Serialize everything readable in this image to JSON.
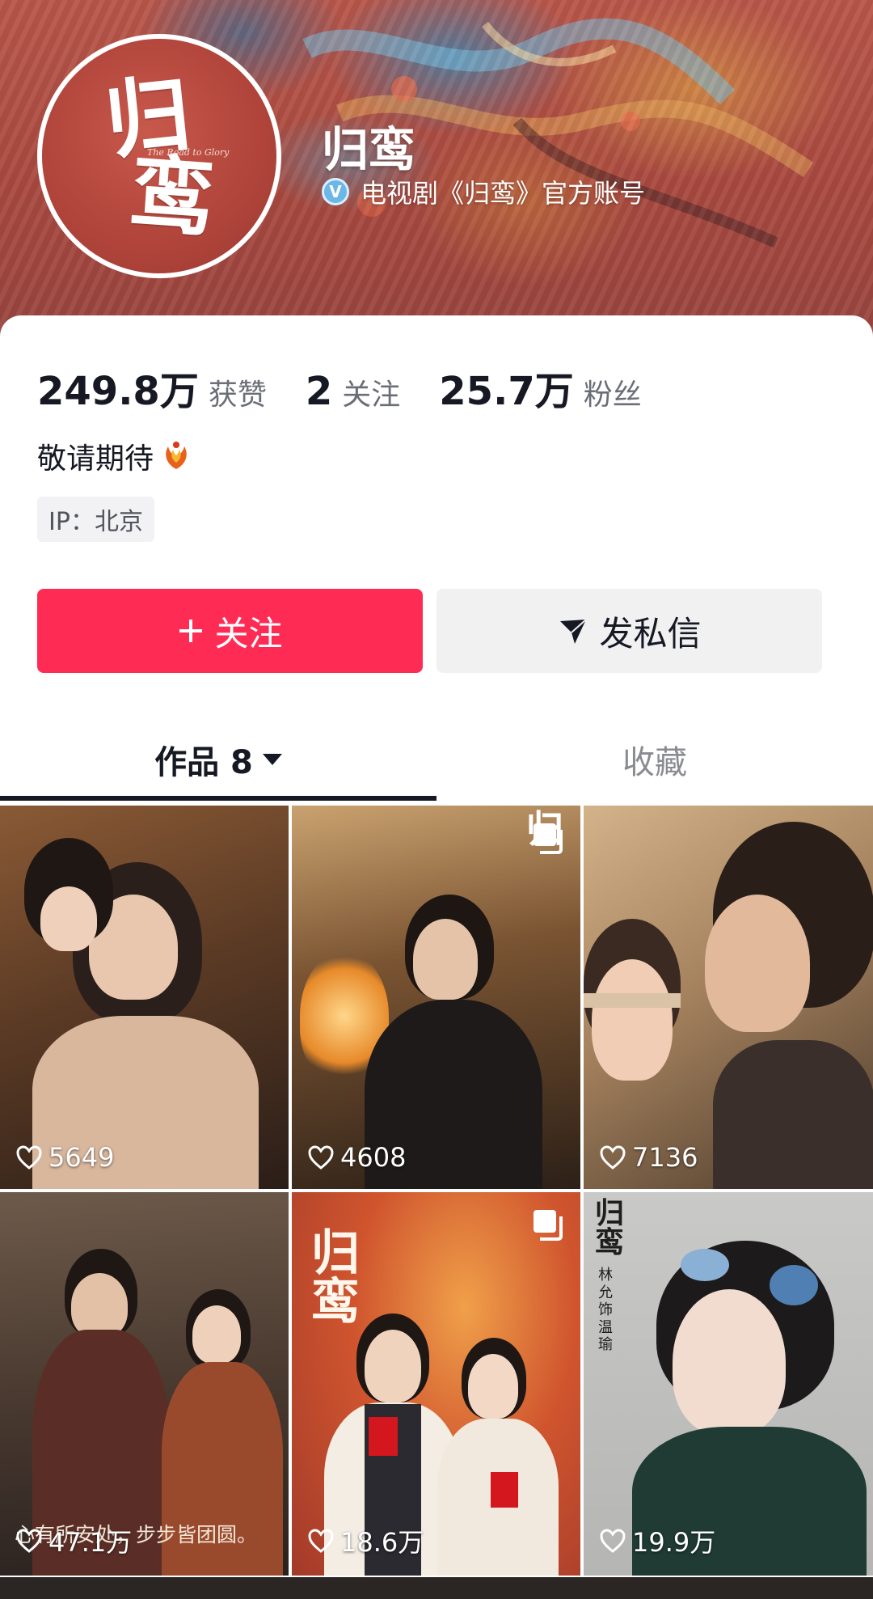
{
  "profile": {
    "avatar_text_top": "归",
    "avatar_text_bottom": "鸾",
    "avatar_text_en": "The Road to Glory",
    "name": "归鸾",
    "verified_icon": "v-verified-icon",
    "verified_text": "电视剧《归鸾》官方账号"
  },
  "stats": [
    {
      "value": "249.8万",
      "label": "获赞"
    },
    {
      "value": "2",
      "label": "关注"
    },
    {
      "value": "25.7万",
      "label": "粉丝"
    }
  ],
  "bio": {
    "text": "敬请期待",
    "emoji": "phoenix-emoji"
  },
  "ip_location": "IP：北京",
  "actions": {
    "follow_label": "关注",
    "follow_icon": "plus-icon",
    "message_label": "发私信",
    "message_icon": "send-icon"
  },
  "tabs": [
    {
      "label": "作品 8",
      "active": true
    },
    {
      "label": "收藏",
      "active": false
    }
  ],
  "videos": [
    {
      "likes": "5649",
      "multi": false
    },
    {
      "likes": "4608",
      "multi": true,
      "poster_text": "归"
    },
    {
      "likes": "7136",
      "multi": false
    },
    {
      "likes": "47.1万",
      "multi": false,
      "caption": "心有所安处，步步皆团圆。"
    },
    {
      "likes": "18.6万",
      "multi": true,
      "poster_text": "归鸾"
    },
    {
      "likes": "19.9万",
      "multi": false,
      "poster_text": "归鸾",
      "poster_sub": "林允 饰 温瑜"
    }
  ],
  "colors": {
    "accent": "#fe2c55",
    "text_primary": "#161823",
    "text_secondary": "#6b6e76"
  }
}
